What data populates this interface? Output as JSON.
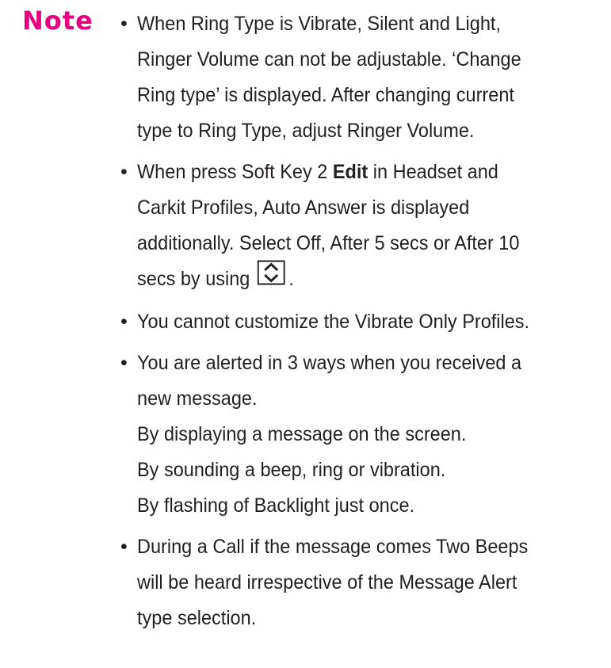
{
  "note": {
    "label": "Note",
    "label_color": "#e6007e"
  },
  "items": [
    {
      "bullet": "•",
      "lines": [
        "When Ring Type is Vibrate, Silent and Light,",
        "Ringer Volume can not be adjustable. ‘Change",
        "Ring type’ is displayed. After changing current",
        "type to Ring Type, adjust Ringer Volume."
      ]
    },
    {
      "bullet": "•",
      "line1_prefix": "When press Soft Key 2 ",
      "line1_bold": "Edit",
      "line1_suffix": " in Headset and",
      "lines": [
        "Carkit Profiles, Auto Answer is displayed",
        "additionally. Select Off, After 5 secs or After 10"
      ],
      "last_line_prefix": "secs by using",
      "nav_icon": "up-down-navigation-key-icon",
      "last_line_suffix": "."
    },
    {
      "bullet": "•",
      "lines": [
        "You cannot customize the Vibrate Only Profiles."
      ]
    },
    {
      "bullet": "•",
      "lines": [
        "You are alerted in 3 ways when you received a",
        "new message.",
        "By displaying a message on the screen.",
        "By sounding a beep, ring or vibration.",
        "By flashing of Backlight just once."
      ]
    },
    {
      "bullet": "•",
      "lines": [
        "During a Call if the message comes Two Beeps",
        "will be heard irrespective of the Message Alert",
        "type selection."
      ]
    }
  ]
}
